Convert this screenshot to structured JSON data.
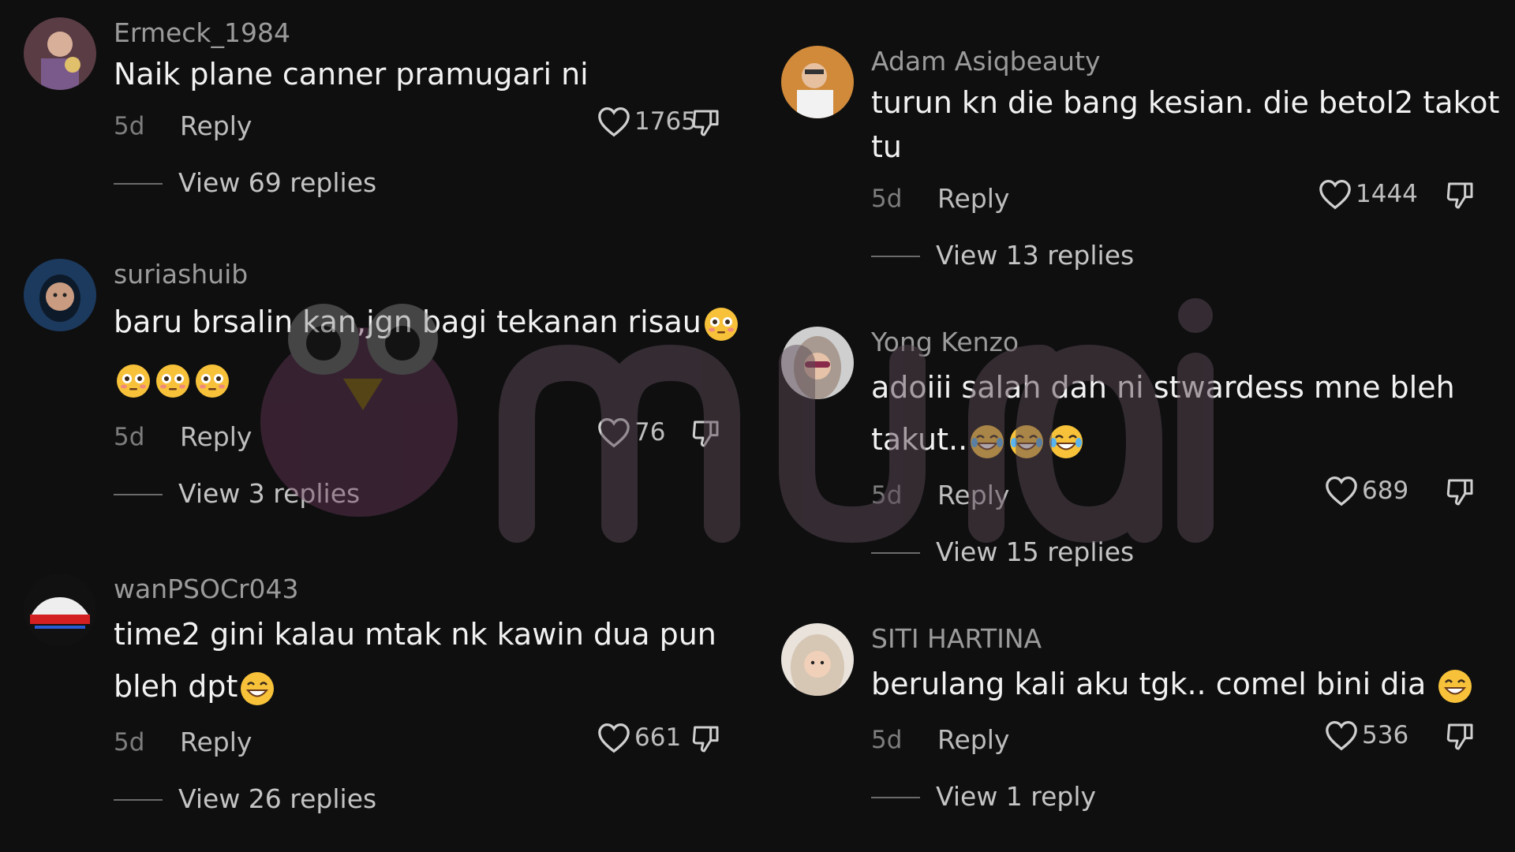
{
  "comments_left": [
    {
      "username": "Ermeck_1984",
      "text": "Naik plane canner pramugari ni",
      "emojis": [],
      "age": "5d",
      "reply_label": "Reply",
      "likes": "1765",
      "view_replies": "View 69 replies",
      "avatar": "avatar-photo"
    },
    {
      "username": "suriashuib",
      "text": "baru brsalin kan,jgn bagi tekanan risau",
      "emojis": [
        "flushed-face",
        "flushed-face",
        "flushed-face",
        "flushed-face"
      ],
      "age": "5d",
      "reply_label": "Reply",
      "likes": "76",
      "view_replies": "View 3 replies",
      "avatar": "avatar-photo"
    },
    {
      "username": "wanPSOCr043",
      "text": "time2 gini kalau mtak nk kawin dua pun bleh dpt",
      "emojis": [
        "grinning-face"
      ],
      "age": "5d",
      "reply_label": "Reply",
      "likes": "661",
      "view_replies": "View 26 replies",
      "avatar": "car-logo"
    }
  ],
  "comments_right": [
    {
      "username": "Adam Asiqbeauty",
      "text": "turun kn die bang kesian. die betol2 takot tu",
      "emojis": [],
      "age": "5d",
      "reply_label": "Reply",
      "likes": "1444",
      "view_replies": "View 13 replies",
      "avatar": "avatar-photo"
    },
    {
      "username": "Yong Kenzo",
      "text": "adoiii salah dah ni stwardess mne bleh takut..",
      "emojis": [
        "tears-of-joy",
        "tears-of-joy",
        "tears-of-joy"
      ],
      "age": "5d",
      "reply_label": "Reply",
      "likes": "689",
      "view_replies": "View 15 replies",
      "avatar": "avatar-photo"
    },
    {
      "username": "SITI HARTINA",
      "text": "berulang kali aku tgk.. comel bini dia",
      "emojis": [
        "grinning-face"
      ],
      "age": "5d",
      "reply_label": "Reply",
      "likes": "536",
      "view_replies": "View 1 reply",
      "avatar": "avatar-photo"
    }
  ],
  "icons": {
    "like": "heart-outline-icon",
    "dislike": "thumbs-down-icon"
  },
  "colors": {
    "background": "#0f0f10",
    "username": "#9b9b9b",
    "text": "#f2f2f2",
    "secondary": "#bdbdbd"
  },
  "watermark_text": "murai"
}
